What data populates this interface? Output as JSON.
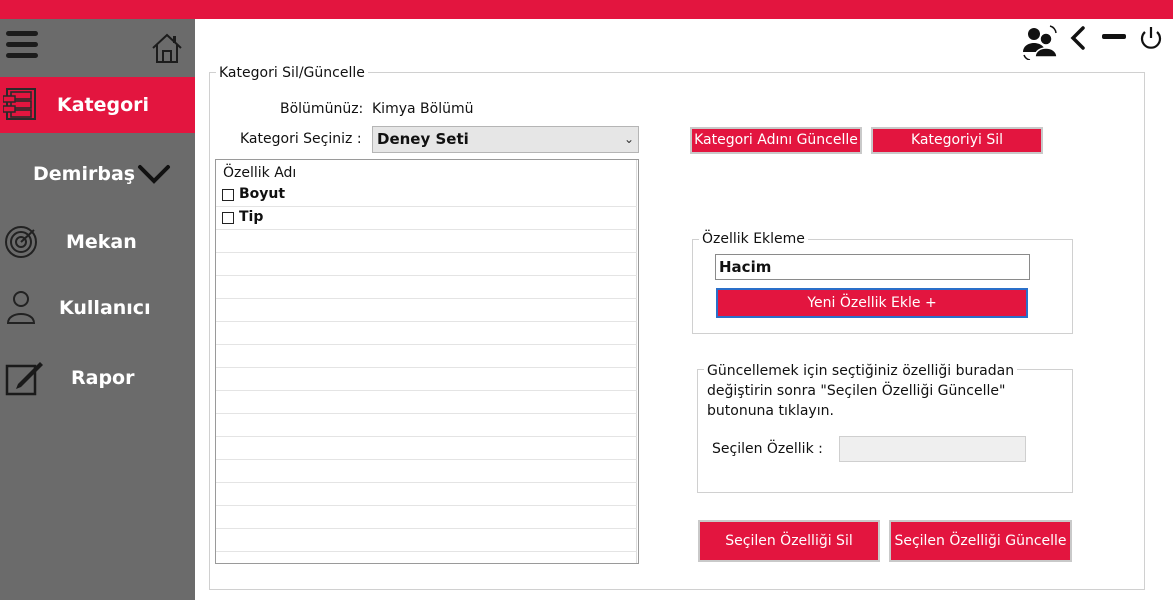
{
  "colors": {
    "accent": "#e3153f",
    "sidebar": "#6b6b6b"
  },
  "sidebar": {
    "menu_icon": "hamburger-icon",
    "home_icon": "home-icon",
    "items": [
      {
        "label": "Kategori",
        "icon": "category-cabinet-icon",
        "active": true
      },
      {
        "label": "Demirbaş",
        "icon": "chevron-down-icon",
        "active": false
      },
      {
        "label": "Mekan",
        "icon": "radar-icon",
        "active": false
      },
      {
        "label": "Kullanıcı",
        "icon": "user-icon",
        "active": false
      },
      {
        "label": "Rapor",
        "icon": "edit-report-icon",
        "active": false
      }
    ]
  },
  "window_controls": {
    "icons": [
      "switch-user-icon",
      "back-icon",
      "minimize-icon",
      "power-icon"
    ]
  },
  "main": {
    "group_title": "Kategori Sil/Güncelle",
    "bolum_label": "Bölümünüz:",
    "bolum_value": "Kimya Bölümü",
    "kategori_label": "Kategori Seçiniz :",
    "kategori_selected": "Deney Seti",
    "list_header": "Özellik Adı",
    "list_items": [
      "Boyut",
      "Tip"
    ],
    "update_name_button": "Kategori Adını Güncelle",
    "delete_category_button": "Kategoriyi Sil",
    "add_group_title": "Özellik Ekleme",
    "new_feature_value": "Hacim",
    "add_feature_button": "Yeni Özellik Ekle +",
    "info_line1": "Güncellemek için seçtiğiniz özelliği  buradan",
    "info_line2": "değiştirin sonra \"Seçilen Özelliği Güncelle\"",
    "info_line3": "butonuna tıklayın.",
    "selected_label": "Seçilen Özellik :",
    "selected_value": "",
    "delete_selected_button": "Seçilen Özelliği Sil",
    "update_selected_button": "Seçilen Özelliği Güncelle"
  }
}
